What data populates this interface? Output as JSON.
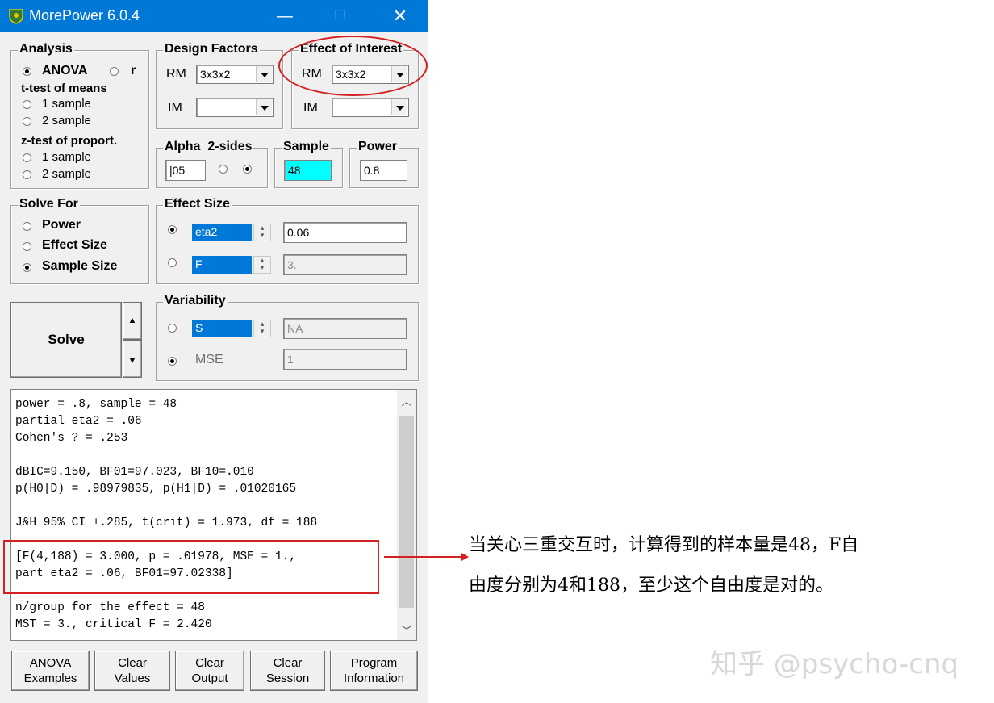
{
  "window": {
    "title": "MorePower 6.0.4",
    "title_bar_color": "#0078d7",
    "controls": {
      "minimize": "—",
      "maximize": "☐",
      "close": "✕"
    }
  },
  "analysis": {
    "title": "Analysis",
    "anova": "ANOVA",
    "r": "r",
    "ttest_heading": "t-test of means",
    "ttest_1": "1 sample",
    "ttest_2": "2 sample",
    "ztest_heading": "z-test of proport.",
    "ztest_1": "1 sample",
    "ztest_2": "2 sample",
    "selected": "ANOVA"
  },
  "design_factors": {
    "title": "Design Factors",
    "rm_label": "RM",
    "rm_value": "3x3x2",
    "im_label": "IM",
    "im_value": ""
  },
  "effect_of_interest": {
    "title": "Effect of Interest",
    "rm_label": "RM",
    "rm_value": "3x3x2",
    "im_label": "IM",
    "im_value": ""
  },
  "alpha": {
    "title": "Alpha",
    "sides_label": "2-sides",
    "value": "|05"
  },
  "sample": {
    "title": "Sample",
    "value": "48"
  },
  "power": {
    "title": "Power",
    "value": "0.8"
  },
  "solve_for": {
    "title": "Solve For",
    "power": "Power",
    "effect_size": "Effect Size",
    "sample_size": "Sample Size",
    "selected": "Sample Size"
  },
  "effect_size": {
    "title": "Effect Size",
    "eta2_label": "eta2",
    "eta2_value": "0.06",
    "f_label": "F",
    "f_value": "3."
  },
  "variability": {
    "title": "Variability",
    "s_label": "S",
    "s_value": "NA",
    "mse_label": "MSE",
    "mse_value": "1"
  },
  "solve_button": "Solve",
  "output": {
    "lines": [
      "power = .8, sample = 48",
      "partial eta2 = .06",
      "Cohen's ? = .253",
      "",
      "dBIC=9.150, BF01=97.023, BF10=.010",
      "p(H0|D) = .98979835, p(H1|D) = .01020165",
      "",
      "J&H 95% CI ±.285, t(crit) = 1.973, df = 188",
      "",
      "[F(4,188) = 3.000, p = .01978, MSE = 1.,",
      "part eta2 = .06, BF01=97.02338]",
      "",
      "n/group for the effect = 48",
      "MST = 3., critical F = 2.420"
    ]
  },
  "buttons": {
    "anova_examples_1": "ANOVA",
    "anova_examples_2": "Examples",
    "clear_values_1": "Clear",
    "clear_values_2": "Values",
    "clear_output_1": "Clear",
    "clear_output_2": "Output",
    "clear_session_1": "Clear",
    "clear_session_2": "Session",
    "program_info_1": "Program",
    "program_info_2": "Information"
  },
  "annotation": {
    "note_line1": "当关心三重交互时，计算得到的样本量是48，F自",
    "note_line2": "由度分别为4和188，至少这个自由度是对的。",
    "color": "#d42020"
  },
  "watermark": "知乎 @psycho-cnq"
}
